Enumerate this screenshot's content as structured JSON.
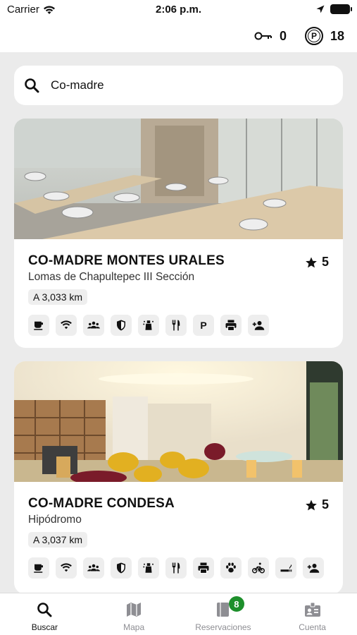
{
  "status_bar": {
    "carrier": "Carrier",
    "time": "2:06 p.m."
  },
  "header": {
    "keys_count": "0",
    "points_label": "P",
    "points_count": "18"
  },
  "search": {
    "value": "Co-madre"
  },
  "results": [
    {
      "name": "CO-MADRE MONTES URALES",
      "area": "Lomas de Chapultepec III Sección",
      "rating": "5",
      "distance": "A 3,033 km",
      "amenities": [
        "coffee",
        "wifi",
        "community",
        "security",
        "cleaning",
        "restaurant",
        "parking",
        "printer",
        "guest"
      ]
    },
    {
      "name": "CO-MADRE CONDESA",
      "area": "Hipódromo",
      "rating": "5",
      "distance": "A 3,037 km",
      "amenities": [
        "coffee",
        "wifi",
        "community",
        "security",
        "cleaning",
        "restaurant",
        "printer",
        "pets",
        "bike",
        "smoking",
        "guest"
      ]
    }
  ],
  "parking_label": "P",
  "tabs": [
    {
      "label": "Buscar",
      "icon": "search-icon",
      "active": true
    },
    {
      "label": "Mapa",
      "icon": "map-icon",
      "active": false
    },
    {
      "label": "Reservaciones",
      "icon": "book-icon",
      "active": false,
      "badge": "8"
    },
    {
      "label": "Cuenta",
      "icon": "id-card-icon",
      "active": false
    }
  ],
  "colors": {
    "badge_green": "#1d8f2b",
    "background": "#ebebeb",
    "inactive_tab": "#8e8e93"
  }
}
